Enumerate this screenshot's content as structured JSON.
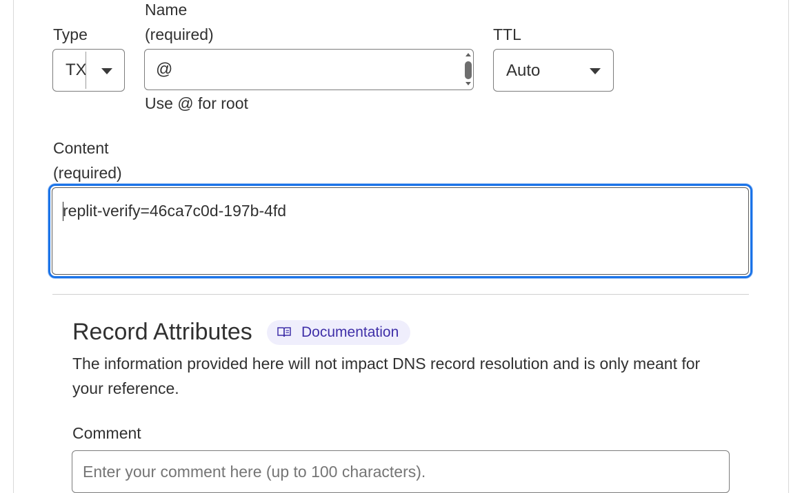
{
  "form": {
    "type": {
      "label": "Type",
      "value": "TX"
    },
    "name": {
      "label_line1": "Name",
      "label_line2": "(required)",
      "value": "@",
      "hint": "Use @ for root"
    },
    "ttl": {
      "label": "TTL",
      "value": "Auto"
    },
    "content": {
      "label_line1": "Content",
      "label_line2": "(required)",
      "value": "replit-verify=46ca7c0d-197b-4fd"
    }
  },
  "attributes": {
    "title": "Record Attributes",
    "doc_link": "Documentation",
    "description": "The information provided here will not impact DNS record resolution and is only meant for your reference.",
    "comment": {
      "label": "Comment",
      "placeholder": "Enter your comment here (up to 100 characters)."
    }
  },
  "colors": {
    "focus": "#1a73e8",
    "chip_bg": "#efeefc",
    "chip_text": "#3f2fa8"
  },
  "icons": {
    "doc": "book-icon",
    "select": "triangle-down-icon"
  }
}
